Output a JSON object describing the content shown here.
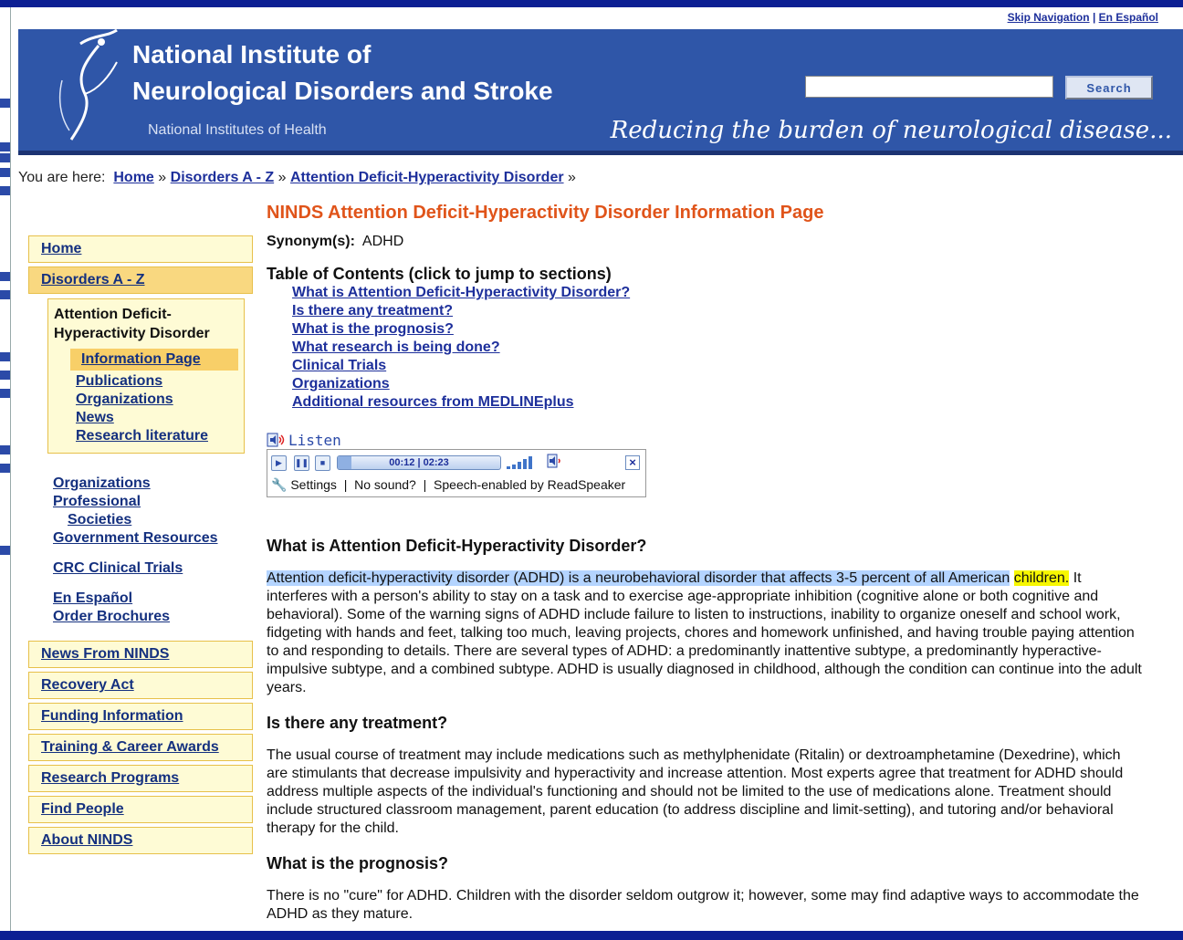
{
  "header": {
    "skip_nav": "Skip Navigation",
    "separator": "|",
    "en_espanol": "En Español",
    "title_line1": "National Institute of",
    "title_line2": "Neurological Disorders and Stroke",
    "subtitle": "National Institutes of Health",
    "tagline": "Reducing the burden of neurological disease...",
    "search_label": "Search",
    "search_value": ""
  },
  "breadcrumb": {
    "prefix": "You are here:",
    "items": [
      "Home",
      "Disorders A - Z",
      "Attention Deficit-Hyperactivity Disorder"
    ],
    "sep": "»"
  },
  "leftnav": {
    "home": "Home",
    "disorders": "Disorders A - Z",
    "sub_title": "Attention Deficit-Hyperactivity Disorder",
    "sub_active": "Information Page",
    "sub_links": [
      "Publications",
      "Organizations",
      "News",
      "Research literature"
    ],
    "plain": [
      "Organizations",
      "Professional",
      "Societies",
      "Government Resources",
      "CRC Clinical Trials",
      "En Español",
      "Order Brochures"
    ],
    "boxes": [
      "News From NINDS",
      "Recovery Act",
      "Funding Information",
      "Training & Career Awards",
      "Research Programs",
      "Find People",
      "About NINDS"
    ]
  },
  "main": {
    "title": "NINDS Attention Deficit-Hyperactivity Disorder Information Page",
    "synonym_label": "Synonym(s):",
    "synonym_value": "ADHD",
    "toc_title": "Table of Contents (click to jump to sections)",
    "toc": [
      "What is Attention Deficit-Hyperactivity Disorder?",
      "Is there any treatment?",
      "What is the prognosis?",
      "What research is being done?",
      "Clinical Trials",
      "Organizations",
      "Additional resources from MEDLINEplus"
    ],
    "listen": {
      "label": "Listen",
      "time": "00:12 | 02:23",
      "progress": 0.084,
      "settings": "Settings",
      "no_sound": "No sound?",
      "speech": "Speech-enabled by",
      "brand": "ReadSpeaker"
    },
    "sections": [
      {
        "heading": "What is Attention Deficit-Hyperactivity Disorder?",
        "highlight_a": "Attention deficit-hyperactivity disorder (ADHD) is a neurobehavioral disorder that affects 3-5 percent of all American",
        "highlight_b": "children.",
        "rest": " It interferes with a person's ability to stay on a task and to exercise age-appropriate inhibition (cognitive alone or both cognitive and behavioral). Some of the warning signs of ADHD include failure to listen to instructions, inability to organize oneself and school work, fidgeting with hands and feet, talking too much, leaving projects, chores and homework unfinished, and having trouble paying attention to and responding to details. There are several types of ADHD: a predominantly inattentive subtype, a predominantly hyperactive-impulsive subtype, and a combined subtype. ADHD is usually diagnosed in childhood, although the condition can continue into the adult years."
      },
      {
        "heading": "Is there any treatment?",
        "body": "The usual course of treatment may include medications such as methylphenidate (Ritalin) or dextroamphetamine (Dexedrine), which are stimulants that decrease impulsivity and hyperactivity and increase attention. Most experts agree that treatment for ADHD should address multiple aspects of the individual's functioning and should not be limited to the use of medications alone. Treatment should include structured classroom management, parent education (to address discipline and limit-setting), and tutoring and/or behavioral therapy for the child."
      },
      {
        "heading": "What is the prognosis?",
        "body": "There is no \"cure\" for ADHD. Children with the disorder seldom outgrow it; however, some may find adaptive ways to accommodate the ADHD as they mature."
      }
    ]
  },
  "colors": {
    "frame": "#0c1f93",
    "header_bg": "#2f56a8",
    "title_accent": "#e0541a",
    "nav_box_bg": "#fefbd5",
    "nav_box_border": "#e7c04a",
    "link": "#1d2f9b"
  }
}
